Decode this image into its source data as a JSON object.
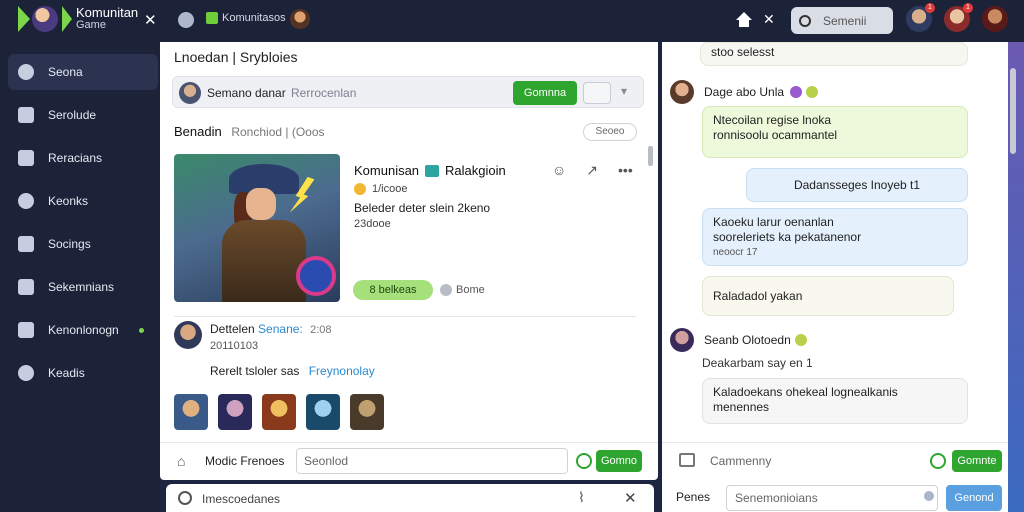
{
  "topbar": {
    "brand_title": "Komunitan",
    "brand_sub": "Game",
    "tab_label": "Komunitasos",
    "search_placeholder": "Semenii",
    "badges": [
      "1",
      "1"
    ]
  },
  "sidebar": {
    "items": [
      {
        "label": "Seona"
      },
      {
        "label": "Serolude"
      },
      {
        "label": "Reracians"
      },
      {
        "label": "Keonks"
      },
      {
        "label": "Socings"
      },
      {
        "label": "Sekemnians"
      },
      {
        "label": "Kenonlonogn"
      },
      {
        "label": "Keadis"
      }
    ]
  },
  "main": {
    "title": "Lnoedan | Srybloies",
    "compose": {
      "name": "Semano danar",
      "placeholder": "Rerrocenlan",
      "button": "Gomnna"
    },
    "section": {
      "title": "Benadin",
      "meta": "Ronchiod | (Ooos",
      "button": "Seoeo"
    },
    "post": {
      "title": "Komunisan",
      "title2": "Ralakgioin",
      "meta1": "1/icooe",
      "desc": "Beleder deter slein 2keno",
      "meta2": "23dooe",
      "tag": "8 belkeas",
      "tag2": "Bome"
    },
    "comment": {
      "author": "Dettelen",
      "tag": "Senane:",
      "time": "2:08",
      "sub": "20110103",
      "text": "Rerelt tsloler sas",
      "highlight": "Freynonolay"
    },
    "reply": {
      "label": "Modic Frenoes",
      "placeholder": "Seonlod",
      "button": "Gomno"
    }
  },
  "bottom_bar": {
    "text": "Imescoedanes"
  },
  "chat": {
    "top_message": "stoo selesst",
    "sender1": "Dage abo Unla",
    "msg1_line1": "Ntecoilan regise lnoka",
    "msg1_line2": "ronnisoolu ocammantel",
    "msg2": "Dadansseges Inoyeb t1",
    "msg3_line1": "Kaoeku larur oenanlan",
    "msg3_line2": "sooreleriets ka pekatanenor",
    "msg3_small": "neoocr 17",
    "msg4": "Raladadol yakan",
    "sender2": "Seanb Olotoedn",
    "plain": "Deakarbam say en 1",
    "msg5_line1": "Kaladoekans ohekeal lognealkanis",
    "msg5_line2": "menennes",
    "input_placeholder": "Cammenny",
    "send": "Gomnte",
    "foot_label": "Penes",
    "foot_placeholder": "Senemonioians",
    "foot_button": "Genond"
  }
}
